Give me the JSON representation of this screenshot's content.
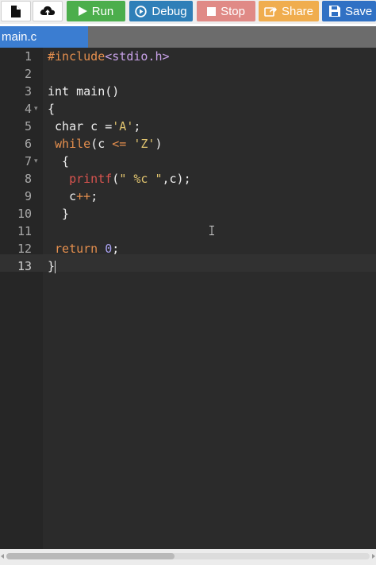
{
  "toolbar": {
    "new_file_icon": "file-icon",
    "upload_icon": "cloud-upload-icon",
    "run_label": "Run",
    "debug_label": "Debug",
    "stop_label": "Stop",
    "share_label": "Share",
    "save_label": "Save",
    "colors": {
      "run": "#4cae4c",
      "debug": "#2f7fb8",
      "stop": "#e08a86",
      "share": "#f0ad4e",
      "save": "#3071c4"
    }
  },
  "tabs": [
    {
      "label": "main.c",
      "active": true
    }
  ],
  "editor": {
    "active_line": 13,
    "line_numbers": [
      "1",
      "2",
      "3",
      "4",
      "5",
      "6",
      "7",
      "8",
      "9",
      "10",
      "11",
      "12",
      "13"
    ],
    "lines": {
      "l1": {
        "include": "#include",
        "header": "<stdio.h>"
      },
      "l3": {
        "text": "int main()"
      },
      "l4": {
        "text": "{"
      },
      "l5": {
        "indent": " ",
        "pre": "char c =",
        "str": "'A'",
        "post": ";"
      },
      "l6": {
        "indent": " ",
        "kw": "while",
        "pre": "(c ",
        "op": "<=",
        "mid": " ",
        "str": "'Z'",
        "post": ")"
      },
      "l7": {
        "text": "  {"
      },
      "l8": {
        "indent": "   ",
        "call": "printf",
        "open": "(",
        "str": "\" %c \"",
        "post": ",c);"
      },
      "l9": {
        "indent": "   ",
        "pre": "c",
        "op": "++",
        "post": ";"
      },
      "l10": {
        "text": "  }"
      },
      "l12": {
        "indent": " ",
        "kw": "return",
        "mid": " ",
        "num": "0",
        "post": ";"
      },
      "l13": {
        "text": "}"
      }
    }
  }
}
